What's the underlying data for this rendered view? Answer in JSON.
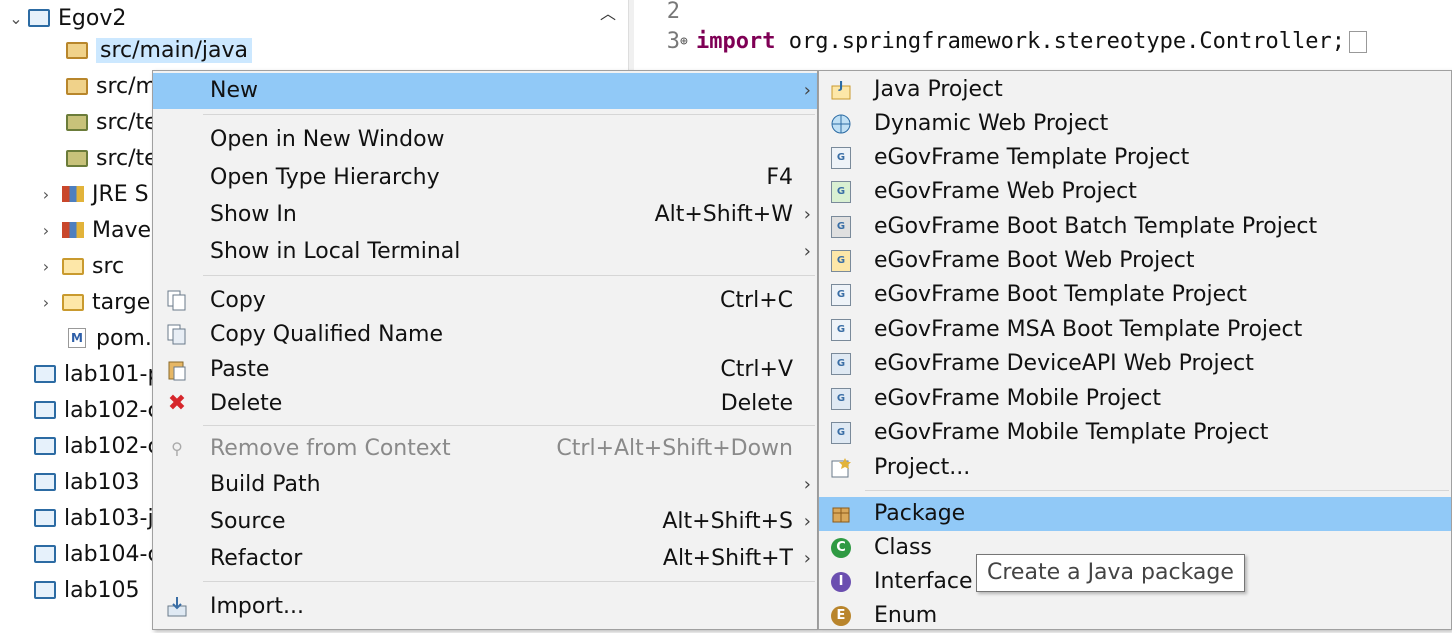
{
  "explorer": {
    "root_project": "Egov2",
    "rows": [
      {
        "label": "src/main/java"
      },
      {
        "label": "src/m"
      },
      {
        "label": "src/te"
      },
      {
        "label": "src/te"
      },
      {
        "label": "JRE S"
      },
      {
        "label": "Mave"
      },
      {
        "label": "src"
      },
      {
        "label": "targe"
      },
      {
        "label": "pom."
      },
      {
        "label": "lab101-p"
      },
      {
        "label": "lab102-c"
      },
      {
        "label": "lab102-c"
      },
      {
        "label": "lab103"
      },
      {
        "label": "lab103-j"
      },
      {
        "label": "lab104-c"
      },
      {
        "label": "lab105"
      }
    ]
  },
  "editor": {
    "lines": [
      {
        "number": "2",
        "text": ""
      },
      {
        "number": "3",
        "keyword": "import",
        "text": " org.springframework.stereotype.Controller;"
      }
    ]
  },
  "context_menu": {
    "items": [
      {
        "label": "New",
        "shortcut": "",
        "arrow": "›"
      },
      {
        "label": "Open in New Window",
        "shortcut": ""
      },
      {
        "label": "Open Type Hierarchy",
        "shortcut": "F4"
      },
      {
        "label": "Show In",
        "shortcut": "Alt+Shift+W",
        "arrow": "›"
      },
      {
        "label": "Show in Local Terminal",
        "shortcut": "",
        "arrow": "›"
      },
      {
        "label": "Copy",
        "shortcut": "Ctrl+C"
      },
      {
        "label": "Copy Qualified Name",
        "shortcut": ""
      },
      {
        "label": "Paste",
        "shortcut": "Ctrl+V"
      },
      {
        "label": "Delete",
        "shortcut": "Delete"
      },
      {
        "label": "Remove from Context",
        "shortcut": "Ctrl+Alt+Shift+Down"
      },
      {
        "label": "Build Path",
        "shortcut": "",
        "arrow": "›"
      },
      {
        "label": "Source",
        "shortcut": "Alt+Shift+S",
        "arrow": "›"
      },
      {
        "label": "Refactor",
        "shortcut": "Alt+Shift+T",
        "arrow": "›"
      },
      {
        "label": "Import...",
        "shortcut": ""
      }
    ]
  },
  "submenu": {
    "items": [
      {
        "label": "Java Project"
      },
      {
        "label": "Dynamic Web Project"
      },
      {
        "label": "eGovFrame Template Project"
      },
      {
        "label": "eGovFrame Web Project"
      },
      {
        "label": "eGovFrame Boot Batch Template Project"
      },
      {
        "label": "eGovFrame Boot Web Project"
      },
      {
        "label": "eGovFrame Boot Template Project"
      },
      {
        "label": "eGovFrame MSA Boot Template Project"
      },
      {
        "label": "eGovFrame DeviceAPI Web Project"
      },
      {
        "label": "eGovFrame Mobile Project"
      },
      {
        "label": "eGovFrame Mobile Template Project"
      },
      {
        "label": "Project..."
      },
      {
        "label": "Package"
      },
      {
        "label": "Class"
      },
      {
        "label": "Interface"
      },
      {
        "label": "Enum"
      }
    ]
  },
  "tooltip": "Create a Java package",
  "colors": {
    "highlight": "#91c9f7",
    "selection": "#cce8ff",
    "keyword": "#7f0055"
  }
}
